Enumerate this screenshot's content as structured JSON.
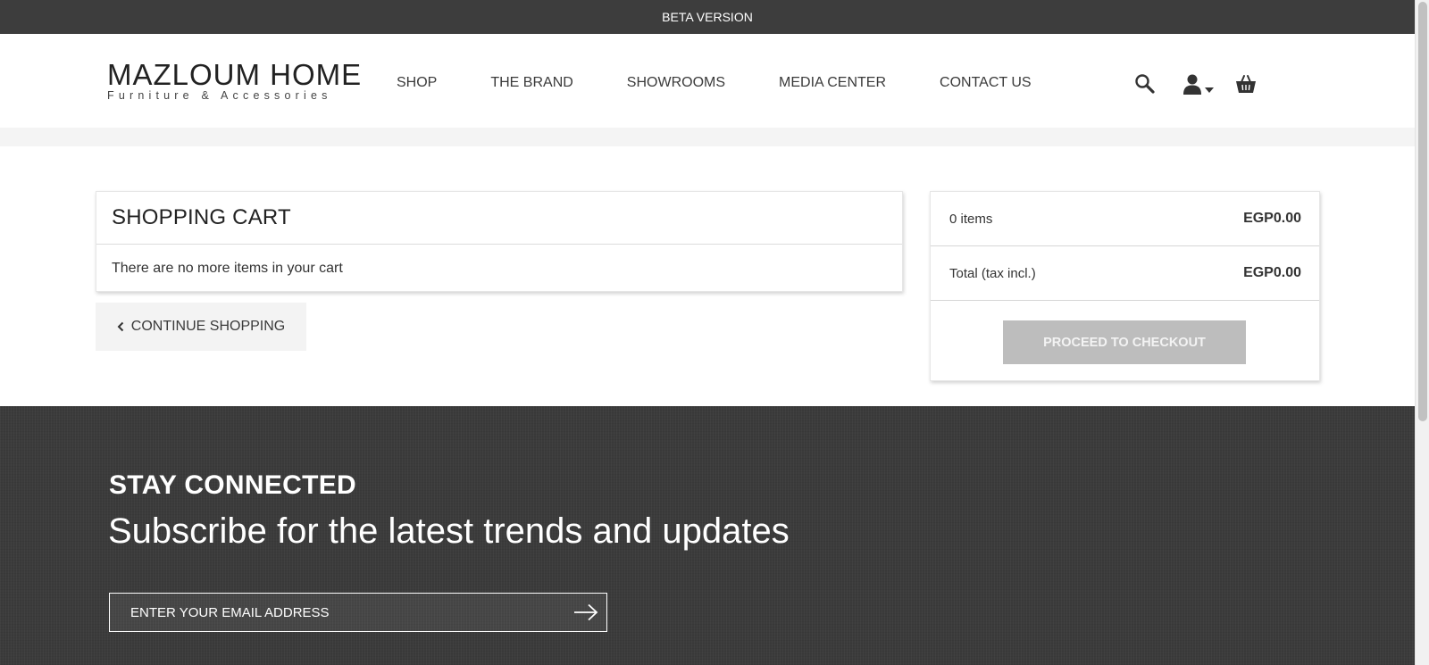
{
  "topbar": {
    "text": "BETA VERSION"
  },
  "header": {
    "logo_main": "MAZLOUM HOME",
    "logo_sub": "Furniture & Accessories",
    "nav": [
      {
        "label": "SHOP"
      },
      {
        "label": "THE BRAND"
      },
      {
        "label": "SHOWROOMS"
      },
      {
        "label": "MEDIA CENTER"
      },
      {
        "label": "CONTACT US"
      }
    ],
    "icons": [
      "search-icon",
      "user-icon",
      "chevron-down-icon",
      "shopping-basket-icon"
    ]
  },
  "cart": {
    "title": "SHOPPING CART",
    "empty_message": "There are no more items in your cart",
    "continue_label": "CONTINUE SHOPPING"
  },
  "summary": {
    "items_label": "0 items",
    "items_value": "EGP0.00",
    "total_label": "Total (tax incl.)",
    "total_value": "EGP0.00",
    "checkout_label": "PROCEED TO CHECKOUT"
  },
  "footer": {
    "heading": "STAY CONNECTED",
    "subheading": "Subscribe for the latest trends and updates",
    "email_placeholder": "ENTER YOUR EMAIL ADDRESS"
  },
  "colors": {
    "topbar_bg": "#3d3d3d",
    "footer_bg": "#3b3b3b",
    "checkout_disabled_bg": "#bdbdbd",
    "continue_bg": "#f3f3f3"
  }
}
